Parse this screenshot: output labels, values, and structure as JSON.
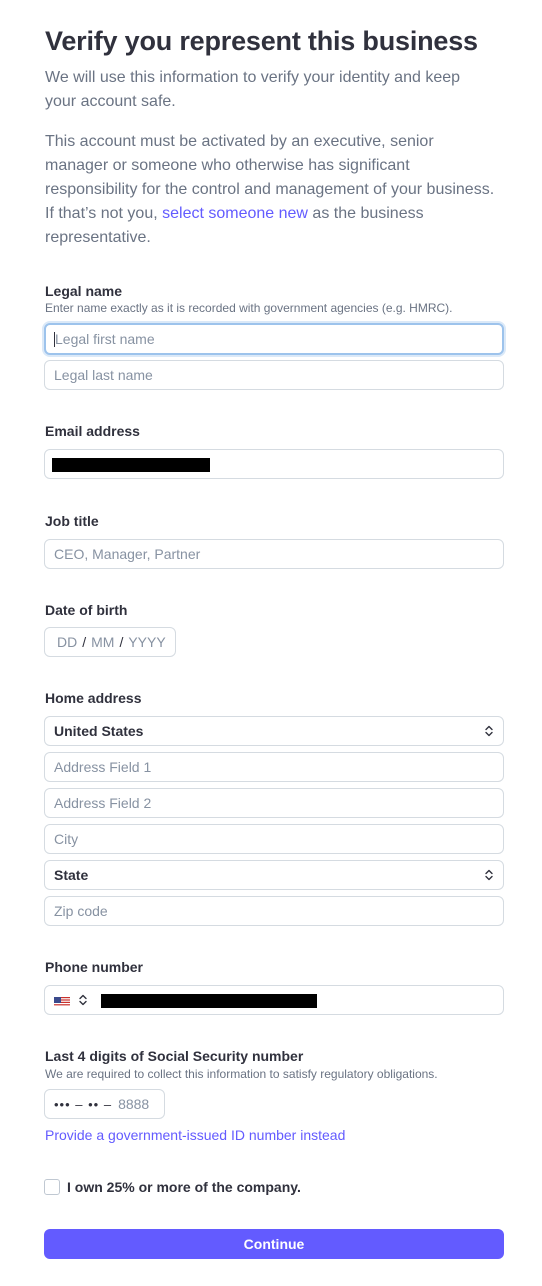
{
  "header": {
    "title": "Verify you represent this business",
    "intro": "We will use this information to verify your identity and keep your account safe.",
    "notice_before": "This account must be activated by an executive, senior manager or someone who otherwise has significant responsibility for the control and management of your business. If that’s not you, ",
    "notice_link": "select someone new",
    "notice_after": " as the business representative."
  },
  "legal_name": {
    "label": "Legal name",
    "help": "Enter name exactly as it is recorded with government agencies (e.g. HMRC).",
    "first_placeholder": "Legal first name",
    "last_placeholder": "Legal last name"
  },
  "email": {
    "label": "Email address",
    "value": ""
  },
  "job_title": {
    "label": "Job title",
    "placeholder": "CEO, Manager, Partner"
  },
  "dob": {
    "label": "Date of birth",
    "dd": "DD",
    "mm": "MM",
    "yyyy": "YYYY",
    "sep": "/"
  },
  "home_address": {
    "label": "Home address",
    "country": "United States",
    "address1_placeholder": "Address Field 1",
    "address2_placeholder": "Address Field 2",
    "city_placeholder": "City",
    "state": "State",
    "zip_placeholder": "Zip code"
  },
  "phone": {
    "label": "Phone number",
    "country_flag": "us-flag-icon",
    "value": ""
  },
  "ssn": {
    "label": "Last 4 digits of Social Security number",
    "help": "We are required to collect this information to satisfy regulatory obligations.",
    "mask": "••• – •• –",
    "placeholder": "8888",
    "alt_link": "Provide a government-issued ID number instead"
  },
  "ownership": {
    "label": "I own 25% or more of the company.",
    "checked": false
  },
  "actions": {
    "continue": "Continue"
  },
  "colors": {
    "accent": "#635bff",
    "focus_ring": "#9dc3ec",
    "border": "#d5dbe1"
  }
}
